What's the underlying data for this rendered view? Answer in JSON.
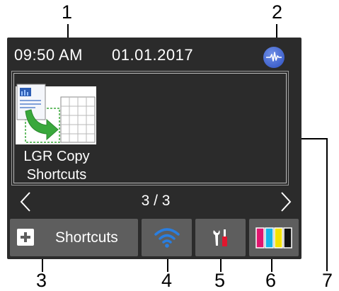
{
  "callouts": {
    "c1": "1",
    "c2": "2",
    "c3": "3",
    "c4": "4",
    "c5": "5",
    "c6": "6",
    "c7": "7"
  },
  "status_bar": {
    "time": "09:50 AM",
    "date": "01.01.2017",
    "status_icon": "machine-status-icon"
  },
  "main_panel": {
    "shortcut": {
      "label_line1": "LGR Copy",
      "label_line2": "Shortcuts",
      "icon": "copy-shortcut-icon"
    }
  },
  "page_nav": {
    "indicator": "3 / 3",
    "prev_icon": "chevron-left-icon",
    "next_icon": "chevron-right-icon"
  },
  "bottom_bar": {
    "shortcuts_label": "Shortcuts",
    "shortcuts_icon": "plus-icon",
    "wifi_icon": "wifi-icon",
    "settings_icon": "tools-icon",
    "ink_icon": "ink-level-icon"
  },
  "colors": {
    "screen_bg": "#2b2b2b",
    "button_bg": "#5e5e5e",
    "wifi_blue": "#2a7ee0",
    "ink_magenta": "#e0166f",
    "ink_cyan": "#16b4e8",
    "ink_yellow": "#f2e200",
    "ink_black": "#111111"
  }
}
